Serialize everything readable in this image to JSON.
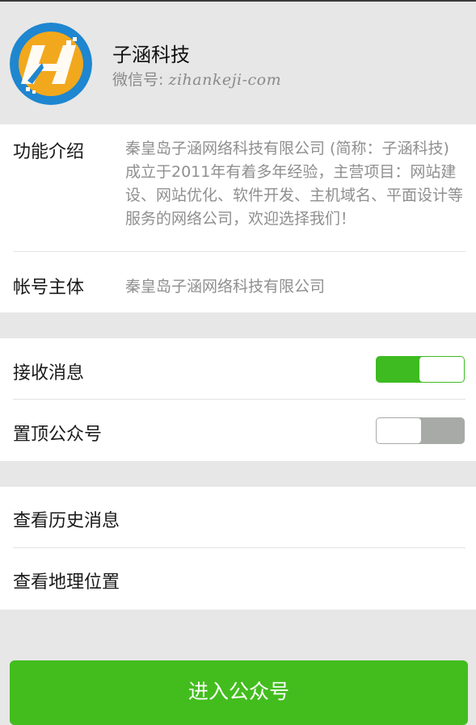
{
  "profile": {
    "name": "子涵科技",
    "wechat_id_label": "微信号: ",
    "wechat_id": "zihankeji-com",
    "avatar_icon": "zihan-h-logo-icon",
    "logo_colors": {
      "outer": "#1f86d0",
      "inner": "#f2a81d",
      "letter": "#ffffff"
    }
  },
  "info": {
    "intro_label": "功能介绍",
    "intro_text": "秦皇岛子涵网络科技有限公司 (简称：子涵科技) 成立于2011年有着多年经验，主营项目：网站建设、网站优化、软件开发、主机域名、平面设计等服务的网络公司，欢迎选择我们！",
    "owner_label": "帐号主体",
    "owner_value": "秦皇岛子涵网络科技有限公司"
  },
  "settings": {
    "receive_label": "接收消息",
    "receive_on": true,
    "pin_label": "置顶公众号",
    "pin_on": false,
    "colors": {
      "toggle_on": "#3dbb20",
      "toggle_off": "#a7aaa7"
    }
  },
  "links": {
    "history_label": "查看历史消息",
    "location_label": "查看地理位置"
  },
  "actions": {
    "enter_label": "进入公众号",
    "accent": "#43bd1e"
  }
}
